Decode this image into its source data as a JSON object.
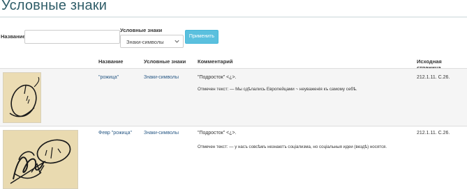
{
  "page": {
    "title": "Условные знаки"
  },
  "filters": {
    "name_label": "Название",
    "name_value": "",
    "signs_label": "Условные знаки",
    "signs_selected": "Знаки-символы",
    "apply_label": "Применить"
  },
  "table": {
    "headers": [
      "Название",
      "Условные знаки",
      "Комментарий",
      "Исходная страница"
    ],
    "rows": [
      {
        "name": "\"рожица\"",
        "signs": "Знаки-символы",
        "comment": "\"Подросток\" <¿>.",
        "marked_text": "Отмечен текст: — Мы сдѣлались Европейцами ~ неуваженія къ самому себѣ.",
        "source_page": "212.1.11. С.26."
      },
      {
        "name": "Февр \"рожица\"",
        "signs": "Знаки-символы",
        "comment": "\"Подросток\" <¿>.",
        "marked_text": "Отмечен текст: — у насъ совсѣмъ незнаютъ соціализма, но соціальныя идеи (вездѣ) носятся.",
        "source_page": "212.1.11. С.26."
      }
    ]
  },
  "icons": {
    "select_arrow": "chevron-down-icon"
  },
  "colors": {
    "title": "#2f5d68",
    "button": "#5bc0de",
    "link": "#2a5a86",
    "row_alt": "#f5f5f5"
  }
}
